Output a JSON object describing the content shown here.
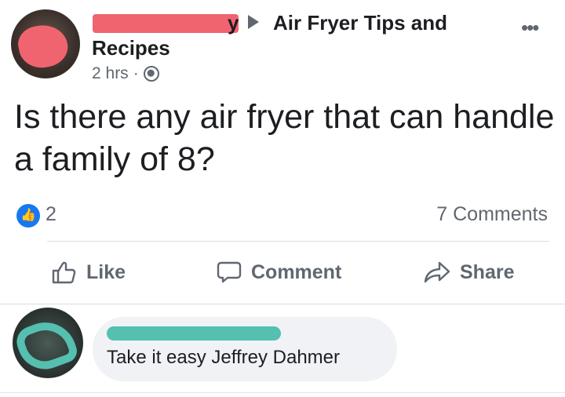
{
  "header": {
    "author_suffix": "y",
    "group_name_line1": "Air Fryer Tips and",
    "group_name_line2": "Recipes",
    "time": "2 hrs",
    "separator": "·",
    "more_label": "•••"
  },
  "post": {
    "text": "Is there any air fryer that can handle a family of 8?"
  },
  "reactions": {
    "like_count": "2",
    "comments_count": "7 Comments"
  },
  "actions": {
    "like": "Like",
    "comment": "Comment",
    "share": "Share"
  },
  "comment": {
    "text": "Take it easy Jeffrey Dahmer"
  },
  "colors": {
    "accent": "#1877f2",
    "redaction_author": "#f06470",
    "redaction_commenter": "#55bfb0",
    "muted_text": "#606770"
  }
}
